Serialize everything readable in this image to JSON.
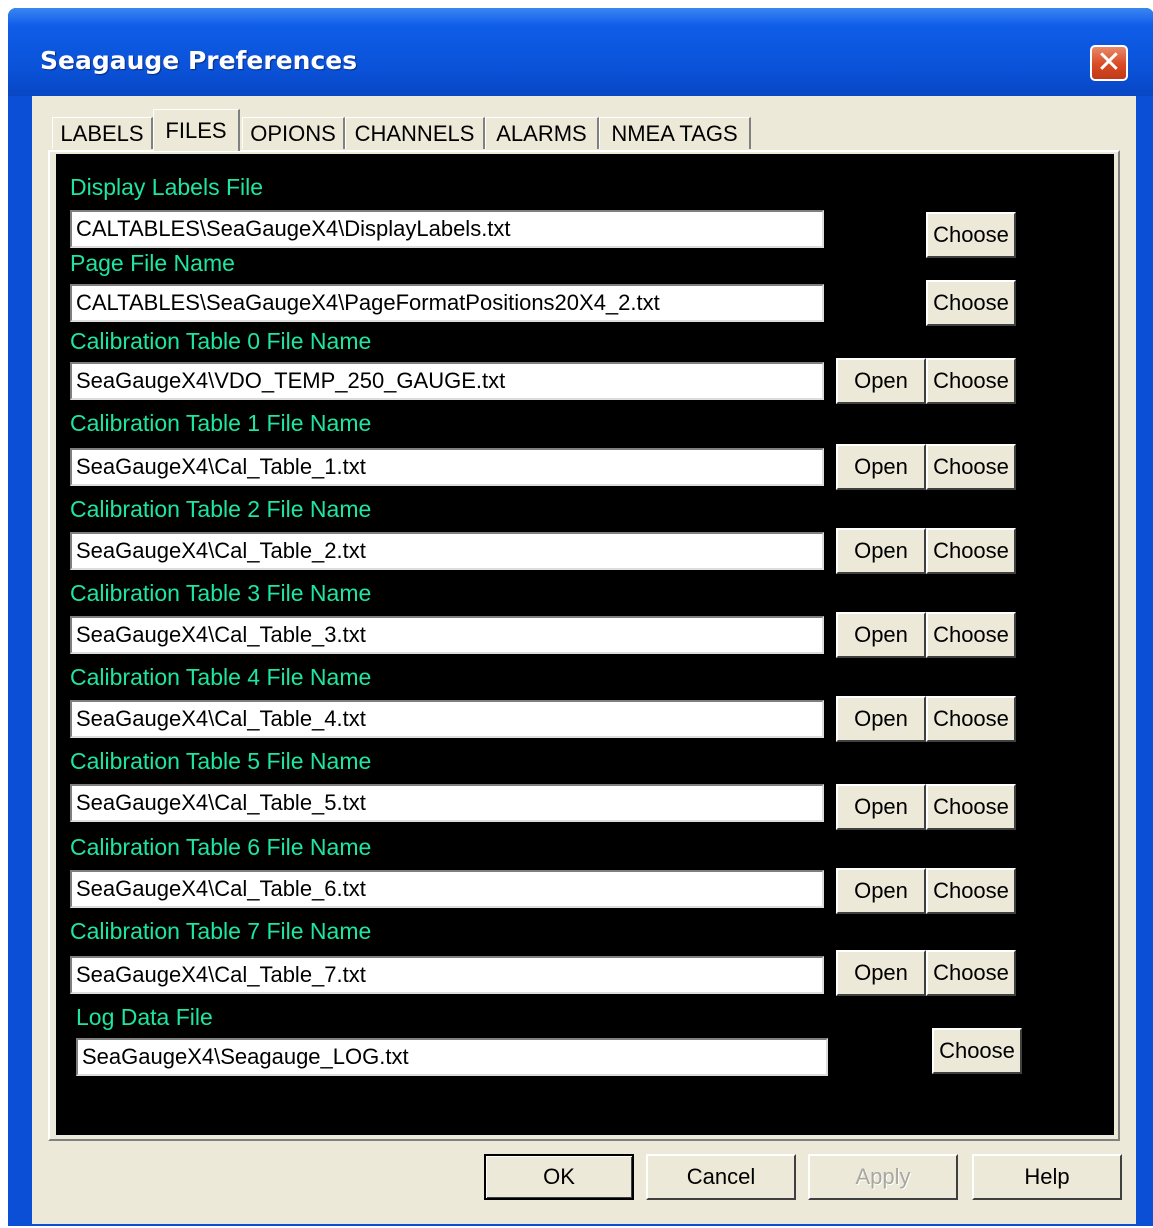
{
  "window": {
    "title": "Seagauge Preferences",
    "close_symbol": "✕"
  },
  "tabs": [
    {
      "label": "LABELS"
    },
    {
      "label": "FILES"
    },
    {
      "label": "OPIONS"
    },
    {
      "label": "CHANNELS"
    },
    {
      "label": "ALARMS"
    },
    {
      "label": "NMEA TAGS"
    }
  ],
  "active_tab": "FILES",
  "fields": [
    {
      "label": "Display Labels File",
      "value": "CALTABLES\\SeaGaugeX4\\DisplayLabels.txt"
    },
    {
      "label": "Page File Name",
      "value": "CALTABLES\\SeaGaugeX4\\PageFormatPositions20X4_2.txt"
    },
    {
      "label": "Calibration Table 0 File Name",
      "value": "SeaGaugeX4\\VDO_TEMP_250_GAUGE.txt"
    },
    {
      "label": "Calibration Table 1 File Name",
      "value": "SeaGaugeX4\\Cal_Table_1.txt"
    },
    {
      "label": "Calibration Table 2 File Name",
      "value": "SeaGaugeX4\\Cal_Table_2.txt"
    },
    {
      "label": "Calibration Table 3 File Name",
      "value": "SeaGaugeX4\\Cal_Table_3.txt"
    },
    {
      "label": "Calibration Table 4 File Name",
      "value": "SeaGaugeX4\\Cal_Table_4.txt"
    },
    {
      "label": "Calibration Table 5 File Name",
      "value": "SeaGaugeX4\\Cal_Table_5.txt"
    },
    {
      "label": "Calibration Table 6 File Name",
      "value": "SeaGaugeX4\\Cal_Table_6.txt"
    },
    {
      "label": "Calibration Table 7 File Name",
      "value": "SeaGaugeX4\\Cal_Table_7.txt"
    },
    {
      "label": "Log Data File",
      "value": "SeaGaugeX4\\Seagauge_LOG.txt"
    }
  ],
  "buttons": {
    "open": "Open",
    "choose": "Choose"
  },
  "dialog_buttons": {
    "ok": "OK",
    "cancel": "Cancel",
    "apply": "Apply",
    "help": "Help"
  },
  "colors": {
    "label_text": "#1ee6a0",
    "panel_bg": "#000000",
    "titlebar": "#0a52d8"
  }
}
